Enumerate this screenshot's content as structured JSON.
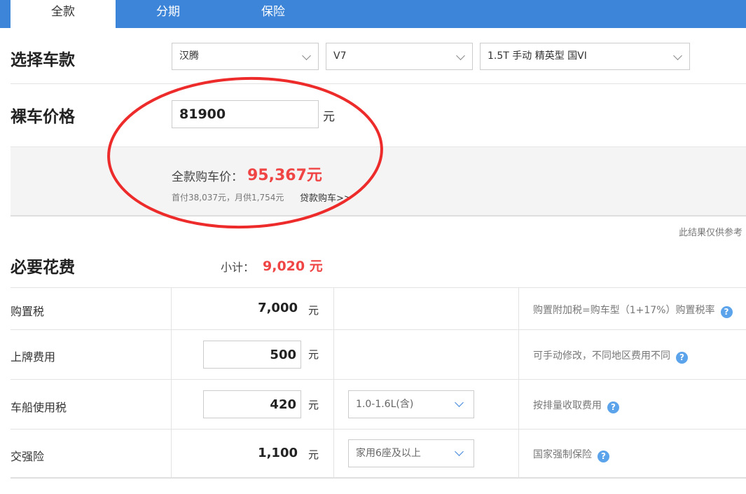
{
  "tabs": [
    {
      "label": "全款",
      "active": true
    },
    {
      "label": "分期",
      "active": false
    },
    {
      "label": "保险",
      "active": false
    }
  ],
  "model_select": {
    "title": "选择车款",
    "brand": "汉腾",
    "series": "V7",
    "trim": "1.5T 手动 精英型 国VI"
  },
  "bare_price": {
    "title": "裸车价格",
    "value": "81900",
    "unit": "元"
  },
  "summary": {
    "total_label": "全款购车价：",
    "total_value": "95,367元",
    "sub_info": "首付38,037元，月供1,754元",
    "loan_link": "贷款购车>>"
  },
  "note": "此结果仅供参考",
  "required_fees": {
    "title": "必要花费",
    "subtotal_label": "小计：",
    "subtotal_value": "9,020 元",
    "rows": [
      {
        "label": "购置税",
        "value": "7,000",
        "unit": "元",
        "option": "",
        "desc": "购置附加税=购车型（1+17%）购置税率"
      },
      {
        "label": "上牌费用",
        "value": "500",
        "unit": "元",
        "option": "",
        "desc": "可手动修改，不同地区费用不同"
      },
      {
        "label": "车船使用税",
        "value": "420",
        "unit": "元",
        "option": "1.0-1.6L(含)",
        "desc": "按排量收取费用"
      },
      {
        "label": "交强险",
        "value": "1,100",
        "unit": "元",
        "option": "家用6座及以上",
        "desc": "国家强制保险"
      }
    ]
  },
  "icons": {
    "help": "question-circle-icon",
    "dropdown": "chevron-down-icon"
  },
  "colors": {
    "tab_bar": "#3d85d8",
    "highlight_red": "#f04545",
    "annotation": "#ee2b2b",
    "help_icon": "#5ba3ea"
  }
}
